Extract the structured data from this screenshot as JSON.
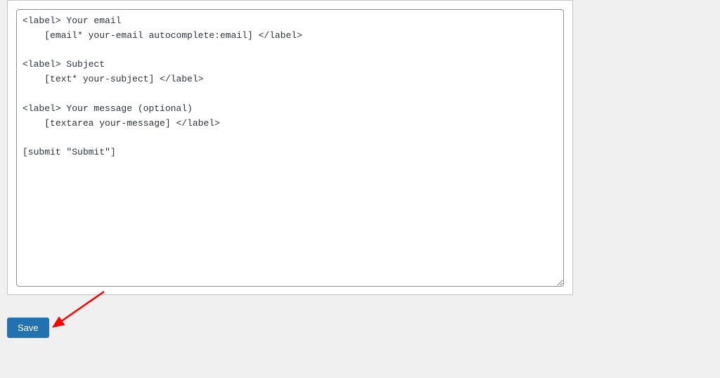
{
  "editor": {
    "content": "<label> Your email\n    [email* your-email autocomplete:email] </label>\n\n<label> Subject\n    [text* your-subject] </label>\n\n<label> Your message (optional)\n    [textarea your-message] </label>\n\n[submit \"Submit\"]"
  },
  "actions": {
    "save_label": "Save"
  },
  "colors": {
    "primary": "#2271b1",
    "annotation": "#ff0000"
  }
}
